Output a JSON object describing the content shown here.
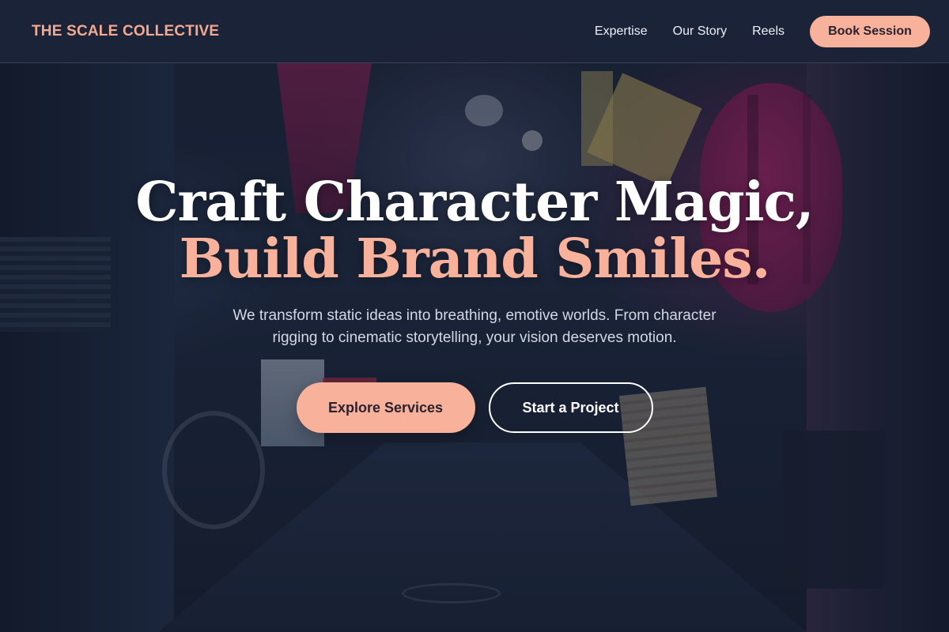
{
  "header": {
    "brand": "THE SCALE COLLECTIVE",
    "nav": [
      {
        "label": "Expertise"
      },
      {
        "label": "Our Story"
      },
      {
        "label": "Reels"
      }
    ],
    "cta_label": "Book Session"
  },
  "hero": {
    "headline_line1": "Craft Character Magic,",
    "headline_line2": "Build Brand Smiles.",
    "subtitle": "We transform static ideas into breathing, emotive worlds. From character rigging to cinematic storytelling, your vision deserves motion.",
    "primary_cta": "Explore Services",
    "secondary_cta": "Start a Project"
  },
  "colors": {
    "accent": "#f8b19a",
    "header_bg": "#1c243a",
    "text": "#ffffff"
  }
}
